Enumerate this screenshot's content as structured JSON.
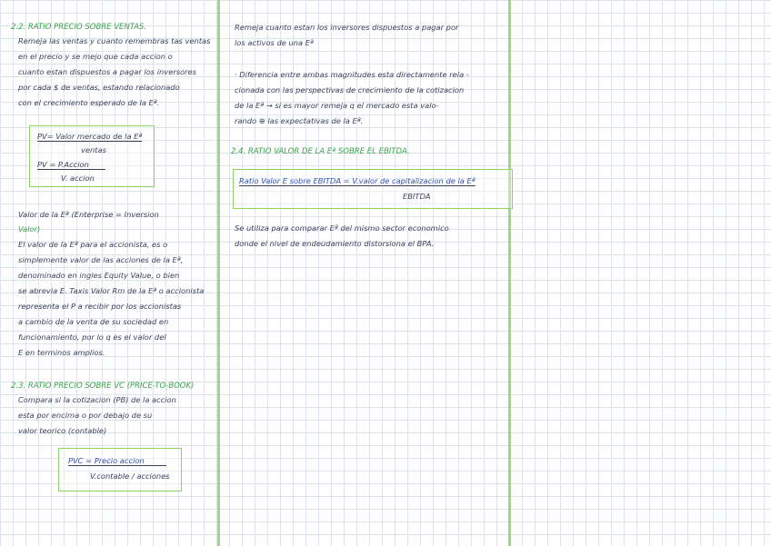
{
  "col1": {
    "h1": "2.2. RATIO PRECIO SOBRE VENTAS.",
    "p1": [
      "Remeja las ventas y cuanto remembras tas ventas",
      "en el precio y se mejo que cada accion o",
      "cuanto estan dispuestos a pagar los inversores",
      "por cada $ de ventas, estando relacionado",
      "con el crecimiento esperado de la Eª."
    ],
    "box1": {
      "line1": "PV= Valor mercado de la Eª",
      "line2": "ventas",
      "line3": "PV = P.Accion",
      "line4": "V. accion"
    },
    "p2": "Valor de la Eª (Enterprise = Inversion",
    "p2b": "Valor)",
    "p3": [
      "El valor de la Eª para el accionista, es o",
      "simplemente valor de las acciones de la Eª,",
      "denominado en ingles Equity Value, o bien",
      "se abrevia E. Taxis Valor Rm de la Eª o accionista",
      "representa el P a recibir por los accionistas",
      "a cambio de la venta de su sociedad en",
      "funcionamiento, por lo q es el valor del",
      "E en terminos amplios."
    ],
    "h2": "2.3. RATIO PRECIO SOBRE VC (PRICE-TO-BOOK)",
    "p4": [
      "Compara si la cotizacion (PB) de la accion",
      "esta por encima o por debajo de su",
      "valor teorico (contable)"
    ],
    "box2": {
      "line1": "PVC = Precio accion",
      "line2": "V.contable / acciones"
    }
  },
  "col2": {
    "p1": [
      "Remeja cuanto estan los inversores dispuestos a pagar por",
      "los activos de una Eª"
    ],
    "p2": [
      "· Diferencia entre ambas magnitudes esta directamente rela -",
      "cionada con las perspectivas de crecimiento de la cotizacion",
      "de la Eª → si es mayor remeja q el mercado esta valo-",
      "rando ⊕ las expectativas de la Eª."
    ],
    "h1": "2.4. RATIO VALOR DE LA Eª SOBRE EL EBITDA.",
    "box": {
      "line1": "Ratio Valor E sobre EBITDA = V.valor de capitalizacion de la Eª",
      "line2": "EBITDA"
    },
    "p3": [
      "Se utiliza para comparar Eª del mismo sector economico",
      "donde el nivel de endeudamiento distorsiona el BPA."
    ]
  }
}
